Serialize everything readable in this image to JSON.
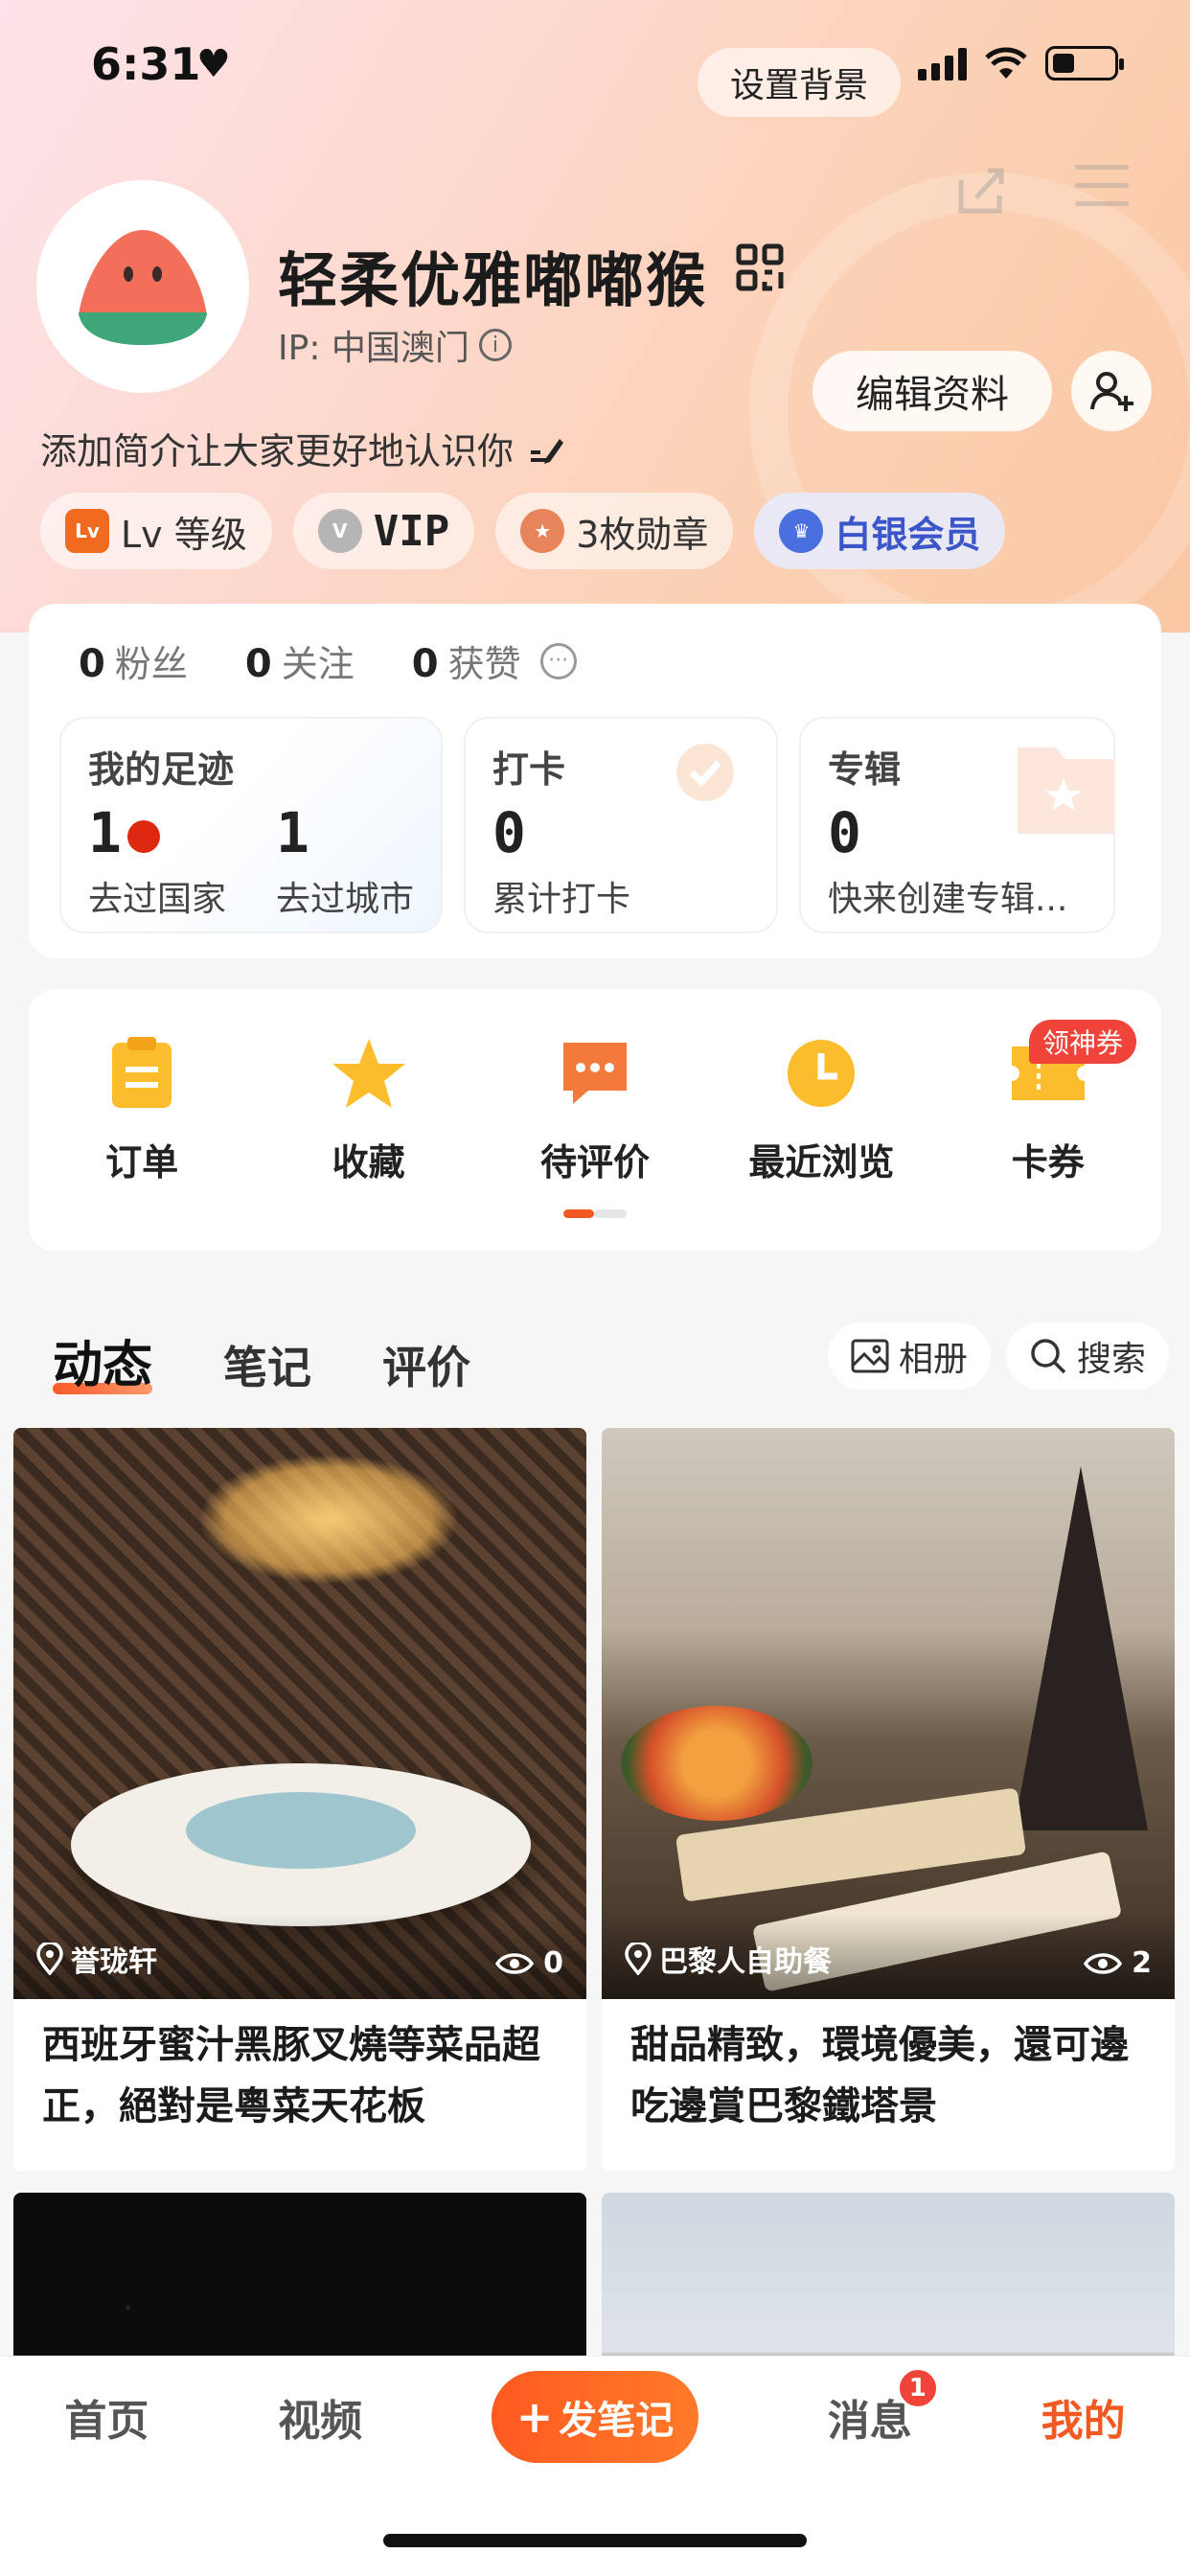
{
  "status_bar": {
    "time": "6:31",
    "heart": "♥"
  },
  "header": {
    "set_background": "设置背景"
  },
  "profile": {
    "nickname": "轻柔优雅嘟嘟猴",
    "ip": "IP: 中国澳门",
    "edit_profile": "编辑资料",
    "bio_placeholder": "添加简介让大家更好地认识你"
  },
  "badges": [
    {
      "icon_text": "Lv",
      "label": "Lv 等级",
      "color": "#f06a1f"
    },
    {
      "icon_text": "V",
      "label": "VIP",
      "color": "#a9a9a9"
    },
    {
      "icon_text": "",
      "label": "3枚勋章",
      "color": "#e8845a"
    },
    {
      "icon_text": "",
      "label": "白银会员",
      "color": "#4a70e0"
    }
  ],
  "stats": {
    "fans": {
      "count": "0",
      "label": "粉丝"
    },
    "follow": {
      "count": "0",
      "label": "关注"
    },
    "likes": {
      "count": "0",
      "label": "获赞"
    }
  },
  "cards": {
    "footprint": {
      "title": "我的足迹",
      "countries": "1",
      "countries_label": "去过国家",
      "cities": "1",
      "cities_label": "去过城市"
    },
    "checkin": {
      "title": "打卡",
      "count": "0",
      "label": "累计打卡"
    },
    "album": {
      "title": "专辑",
      "count": "0",
      "label": "快来创建专辑..."
    }
  },
  "shortcuts": [
    {
      "label": "订单",
      "icon": "clipboard-icon"
    },
    {
      "label": "收藏",
      "icon": "star-icon"
    },
    {
      "label": "待评价",
      "icon": "comment-icon"
    },
    {
      "label": "最近浏览",
      "icon": "clock-icon"
    },
    {
      "label": "卡券",
      "icon": "ticket-icon"
    }
  ],
  "coupon_tag": "领神券",
  "tabs": {
    "dynamic": "动态",
    "notes": "笔记",
    "reviews": "评价",
    "album": "相册",
    "search": "搜索"
  },
  "feed": [
    {
      "location": "誉珑轩",
      "views": "0",
      "caption": "西班牙蜜汁黑豚叉燒等菜品超正，絕對是粵菜天花板"
    },
    {
      "location": "巴黎人自助餐",
      "views": "2",
      "caption": "甜品精致，環境優美，還可邊吃邊賞巴黎鐵塔景"
    }
  ],
  "bottom_nav": {
    "home": "首页",
    "video": "视频",
    "post": "发笔记",
    "messages": "消息",
    "messages_badge": "1",
    "mine": "我的"
  },
  "colors": {
    "accent": "#f05a22",
    "badge_red": "#f0443a"
  }
}
